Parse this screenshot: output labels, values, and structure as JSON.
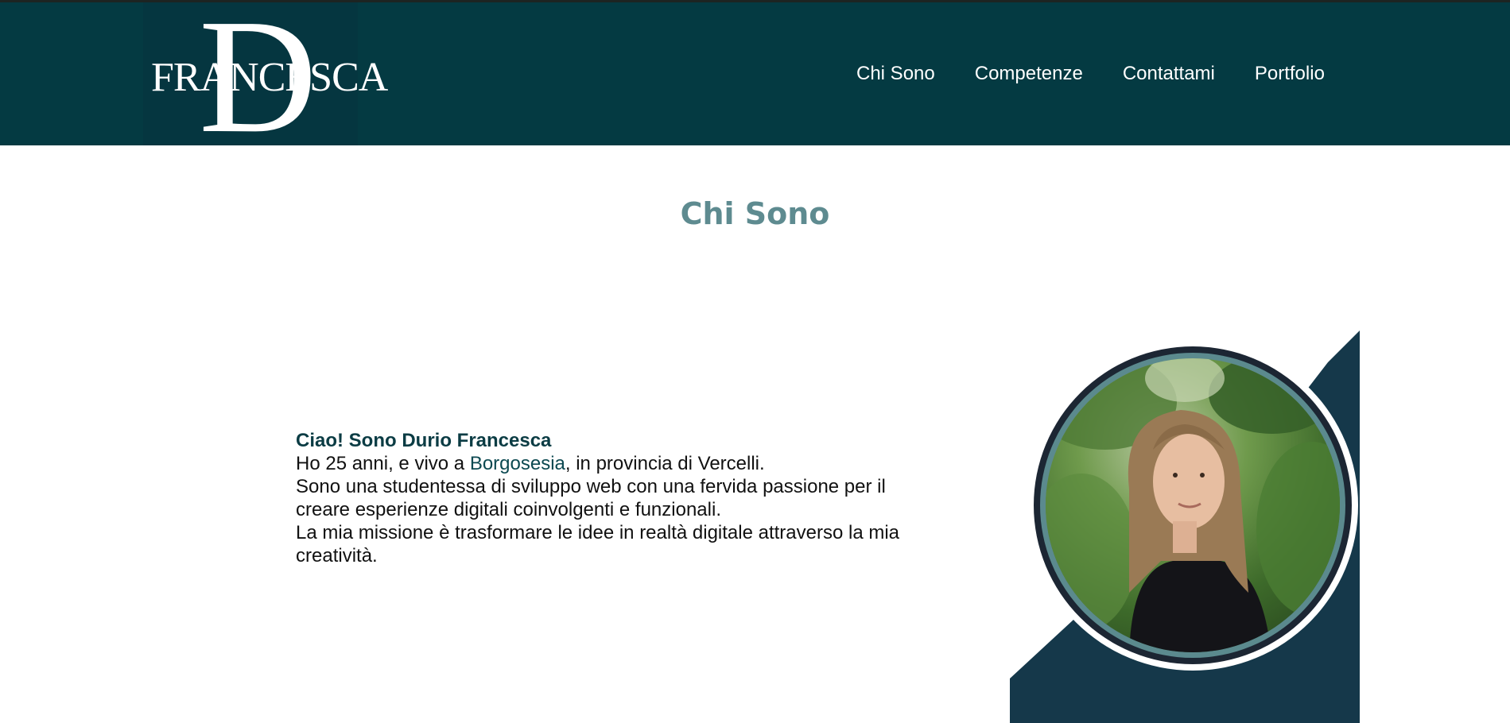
{
  "colors": {
    "header_bg": "#043a42",
    "title": "#5e8b90",
    "link": "#0c4951",
    "panel": "#15384a"
  },
  "header": {
    "logo": {
      "letter": "D",
      "text": "FRANCESCA"
    },
    "nav": [
      {
        "label": "Chi Sono"
      },
      {
        "label": "Competenze"
      },
      {
        "label": "Contattami"
      },
      {
        "label": "Portfolio"
      }
    ]
  },
  "main": {
    "title": "Chi Sono",
    "intro": {
      "greeting": "Ciao! Sono Durio Francesca",
      "line1_pre": "Ho 25 anni, e vivo a ",
      "line1_link": "Borgosesia",
      "line1_post": ", in provincia di Vercelli.",
      "line2": "Sono una studentessa di sviluppo web con una fervida passione per il creare esperienze digitali coinvolgenti e funzionali.",
      "line3": "La mia missione è trasformare le idee in realtà digitale attraverso la mia creatività."
    },
    "photo": {
      "subject": "portrait-photo"
    }
  }
}
